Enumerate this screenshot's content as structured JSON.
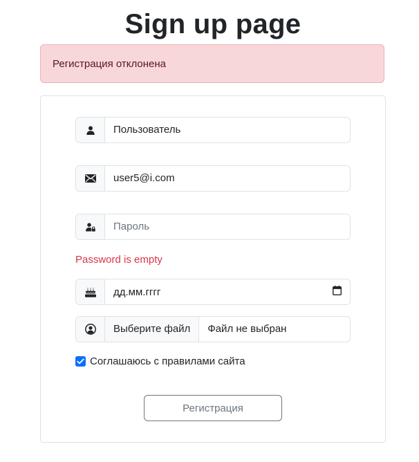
{
  "header": {
    "title": "Sign up page"
  },
  "alert": {
    "message": "Регистрация отклонена"
  },
  "form": {
    "username": {
      "value": "Пользователь",
      "icon": "user-icon"
    },
    "email": {
      "value": "user5@i.com",
      "icon": "envelope-icon"
    },
    "password": {
      "value": "",
      "placeholder": "Пароль",
      "icon": "user-lock-icon",
      "error": "Password is empty"
    },
    "birthdate": {
      "value": "дд.мм.гггг",
      "icon": "birthday-cake-icon",
      "picker_icon": "calendar-icon"
    },
    "avatar": {
      "button_label": "Выберите файл",
      "file_name": "Файл не выбран",
      "icon": "user-circle-icon"
    },
    "agree": {
      "label": "Соглашаюсь с правилами сайта",
      "checked": true
    },
    "submit_label": "Регистрация"
  },
  "colors": {
    "alert_bg": "#f8d7da",
    "alert_text": "#58151c",
    "error_text": "#dc3545",
    "checkbox_accent": "#0d6efd",
    "button_border": "#6c757d"
  }
}
